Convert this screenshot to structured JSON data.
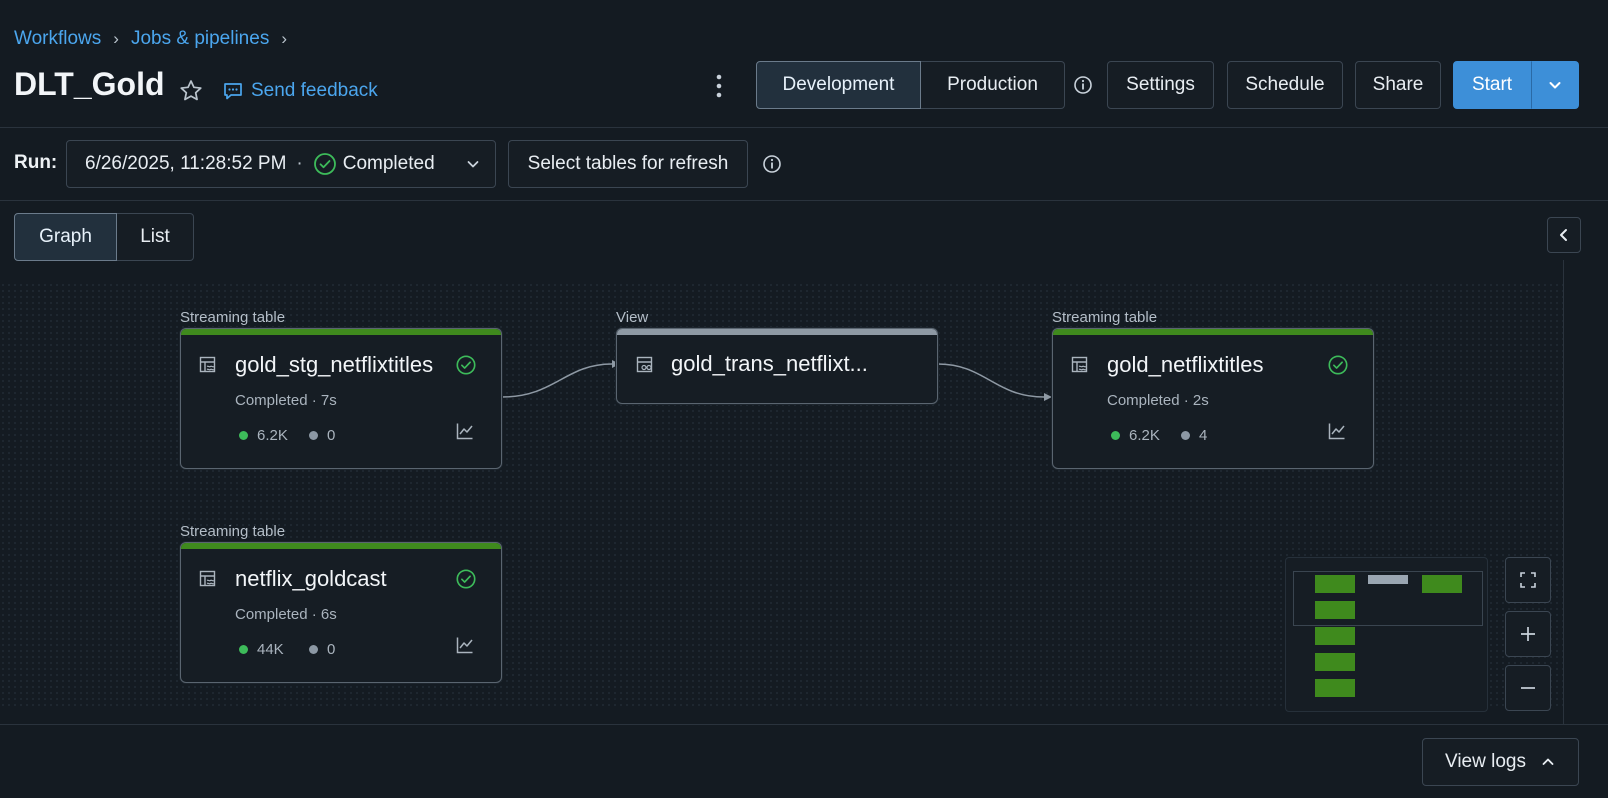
{
  "breadcrumb": {
    "items": [
      "Workflows",
      "Jobs & pipelines"
    ]
  },
  "header": {
    "title": "DLT_Gold",
    "feedback_label": "Send feedback",
    "dev_label": "Development",
    "prod_label": "Production",
    "settings_label": "Settings",
    "schedule_label": "Schedule",
    "share_label": "Share",
    "start_label": "Start"
  },
  "run": {
    "label": "Run:",
    "timestamp": "6/26/2025, 11:28:52 PM",
    "separator": "·",
    "status": "Completed",
    "refresh_label": "Select tables for refresh"
  },
  "view_tabs": {
    "graph_label": "Graph",
    "list_label": "List"
  },
  "nodes": [
    {
      "type": "Streaming table",
      "name": "gold_stg_netflixtitles",
      "status": "Completed · 7s",
      "metric_green": "6.2K",
      "metric_gray": "0"
    },
    {
      "type": "View",
      "name": "gold_trans_netflixt..."
    },
    {
      "type": "Streaming table",
      "name": "gold_netflixtitles",
      "status": "Completed · 2s",
      "metric_green": "6.2K",
      "metric_gray": "4"
    },
    {
      "type": "Streaming table",
      "name": "netflix_goldcast",
      "status": "Completed · 6s",
      "metric_green": "44K",
      "metric_gray": "0"
    }
  ],
  "footer": {
    "view_logs_label": "View logs"
  },
  "colors": {
    "accent": "#3d8fd8",
    "success": "#3dbb5a",
    "streaming_bar": "#3f8a1d",
    "view_bar": "#8e99a4"
  }
}
